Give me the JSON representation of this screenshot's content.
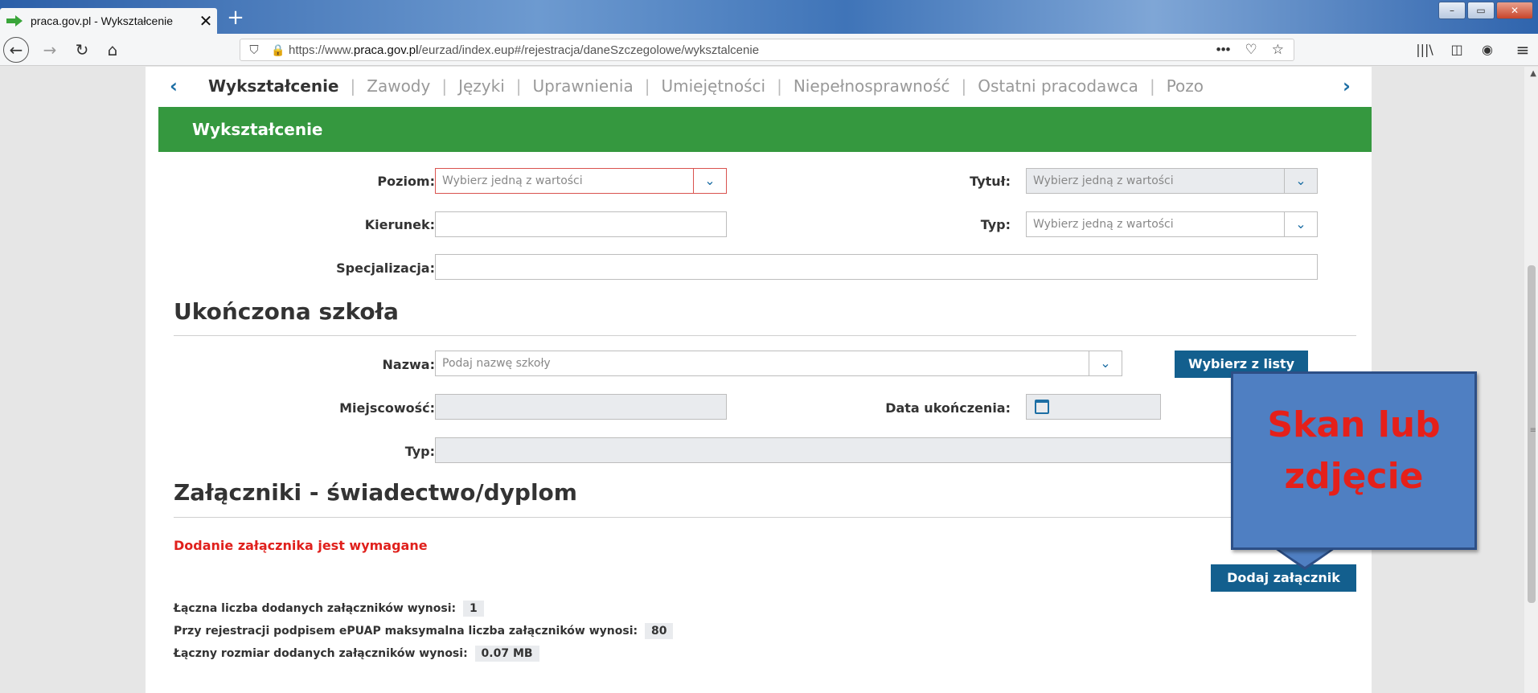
{
  "browser": {
    "tab_title": "praca.gov.pl - Wykształcenie",
    "url_prefix": "https://www.",
    "url_domain": "praca.gov.pl",
    "url_path": "/eurzad/index.eup#/rejestracja/daneSzczegolowe/wyksztalcenie",
    "more_label": "•••",
    "new_tab_label": "+",
    "close_tab_label": "✕"
  },
  "subnav": {
    "items": [
      "Wykształcenie",
      "Zawody",
      "Języki",
      "Uprawnienia",
      "Umiejętności",
      "Niepełnosprawność",
      "Ostatni pracodawca",
      "Pozo"
    ],
    "separator": "|",
    "prev_label": "‹",
    "next_label": "›"
  },
  "section": {
    "header": "Wykształcenie"
  },
  "form": {
    "poziom_label": "Poziom:",
    "poziom_placeholder": "Wybierz jedną z wartości",
    "tytul_label": "Tytuł:",
    "tytul_placeholder": "Wybierz jedną z wartości",
    "kierunek_label": "Kierunek:",
    "typ1_label": "Typ:",
    "typ1_placeholder": "Wybierz jedną z wartości",
    "specjalizacja_label": "Specjalizacja:"
  },
  "school": {
    "heading": "Ukończona szkoła",
    "nazwa_label": "Nazwa:",
    "nazwa_placeholder": "Podaj nazwę szkoły",
    "choose_button": "Wybierz z listy",
    "miejscowosc_label": "Miejscowość:",
    "data_label": "Data ukończenia:",
    "typ_label": "Typ:"
  },
  "attachments": {
    "heading": "Załączniki - świadectwo/dyplom",
    "required_msg": "Dodanie załącznika jest wymagane",
    "add_button": "Dodaj załącznik",
    "count_label": "Łączna liczba dodanych załączników wynosi:",
    "count_value": "1",
    "max_label": "Przy rejestracji podpisem ePUAP maksymalna liczba załączników wynosi:",
    "max_value": "80",
    "size_label": "Łączny rozmiar dodanych załączników wynosi:",
    "size_value": "0.07 MB"
  },
  "callout": {
    "line1": "Skan lub",
    "line2": "zdjęcie"
  },
  "colors": {
    "green_header": "#35983f",
    "primary_blue": "#135f8e",
    "error_red": "#e0201c",
    "callout_fill": "#4f7fc2"
  }
}
